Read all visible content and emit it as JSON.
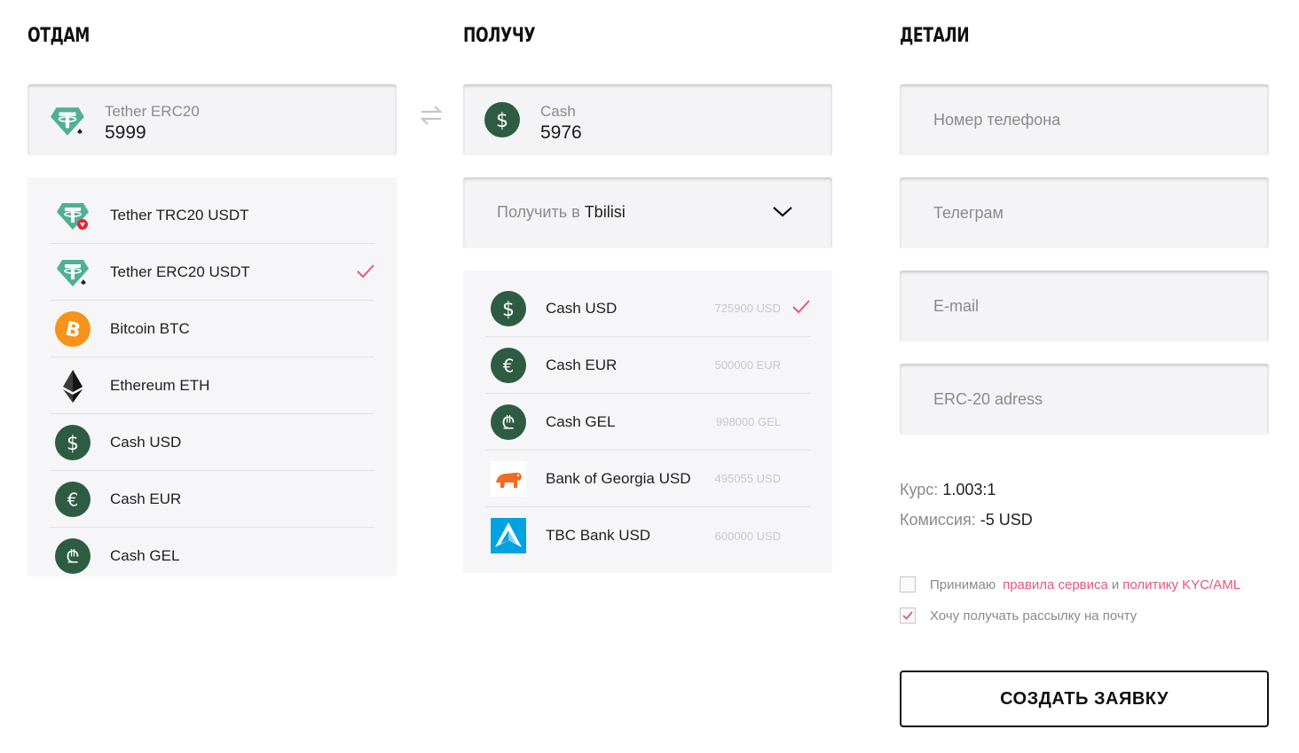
{
  "give": {
    "title": "ОТДАМ",
    "current_label": "Tether ERC20",
    "current_value": "5999",
    "current_icon": "tether-erc20-icon",
    "items": [
      {
        "label": "Tether TRC20 USDT",
        "icon": "tether-trc20-icon"
      },
      {
        "label": "Tether ERC20 USDT",
        "icon": "tether-erc20-icon",
        "selected": true
      },
      {
        "label": "Bitcoin BTC",
        "icon": "bitcoin-icon"
      },
      {
        "label": "Ethereum ETH",
        "icon": "ethereum-icon"
      },
      {
        "label": "Cash USD",
        "icon": "dollar-icon"
      },
      {
        "label": "Cash EUR",
        "icon": "euro-icon"
      },
      {
        "label": "Cash GEL",
        "icon": "lari-icon"
      }
    ]
  },
  "get": {
    "title": "ПОЛУЧУ",
    "current_label": "Cash",
    "current_value": "5976",
    "current_icon": "dollar-icon",
    "city_prefix": "Получить в ",
    "city": "Tbilisi",
    "items": [
      {
        "label": "Cash USD",
        "amount": "725900 USD",
        "icon": "dollar-icon",
        "selected": true
      },
      {
        "label": "Cash EUR",
        "amount": "500000 EUR",
        "icon": "euro-icon"
      },
      {
        "label": "Cash GEL",
        "amount": "998000 GEL",
        "icon": "lari-icon"
      },
      {
        "label": "Bank of Georgia USD",
        "amount": "495055 USD",
        "icon": "bank-of-georgia-icon"
      },
      {
        "label": "TBC Bank USD",
        "amount": "600000 USD",
        "icon": "tbc-bank-icon"
      }
    ]
  },
  "details": {
    "title": "ДЕТАЛИ",
    "phone_placeholder": "Номер телефона",
    "telegram_placeholder": "Телеграм",
    "email_placeholder": "E-mail",
    "address_placeholder": "ERC-20 adress",
    "rate_label": "Курс:",
    "rate_value": "1.003:1",
    "fee_label": "Комиссия:",
    "fee_value": "-5 USD",
    "agree_prefix": "Принимаю",
    "agree_link_rules": "правила сервиса",
    "agree_and": "и",
    "agree_link_kyc": "политику KYC/AML",
    "agree_checked": false,
    "newsletter_label": "Хочу получать рассылку на почту",
    "newsletter_checked": true,
    "submit_label": "СОЗДАТЬ ЗАЯВКУ"
  },
  "colors": {
    "accent": "#e8577a",
    "cash_green": "#2e5c42",
    "tether_green": "#50af95",
    "bitcoin_orange": "#f7931a",
    "tbc_blue": "#00a3e0"
  }
}
